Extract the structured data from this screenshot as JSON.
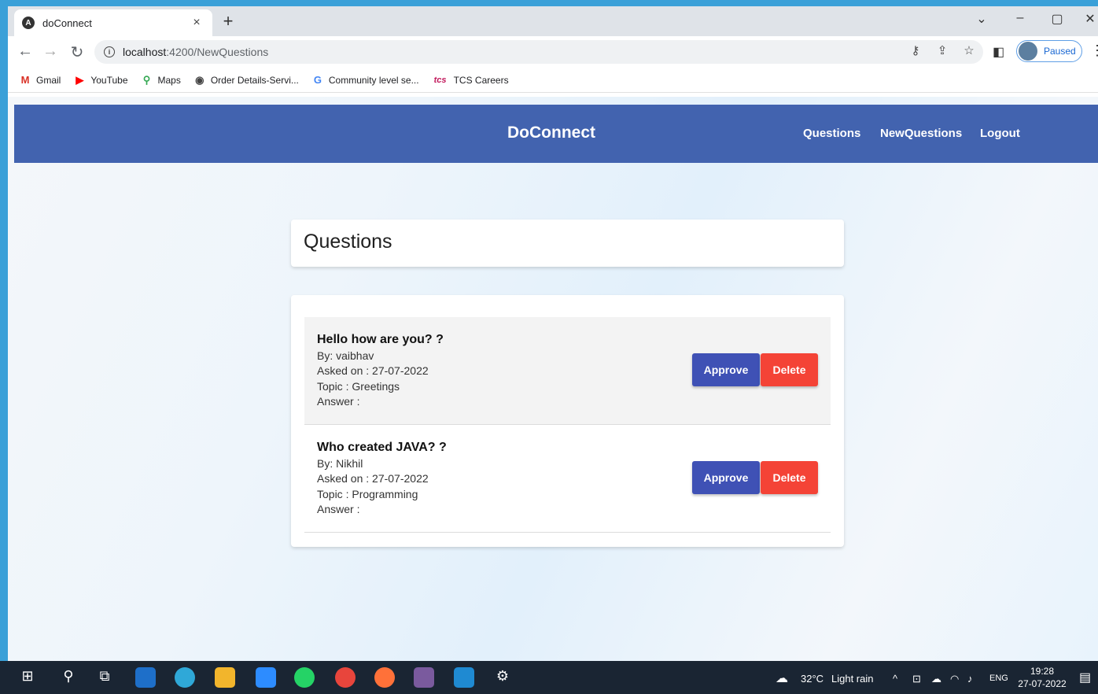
{
  "browser": {
    "tab_title": "doConnect",
    "tab_favicon": "A",
    "tab_close": "×",
    "new_tab": "+",
    "url_host": "localhost",
    "url_path": ":4200/NewQuestions",
    "profile_status": "Paused",
    "window_controls": [
      "⌄",
      "–",
      "▢",
      "✕"
    ]
  },
  "bookmarks": [
    {
      "icon": "M",
      "label": "Gmail",
      "color": "#d93025"
    },
    {
      "icon": "▶",
      "label": "YouTube",
      "color": "#ff0000"
    },
    {
      "icon": "⚲",
      "label": "Maps",
      "color": "#34a853"
    },
    {
      "icon": "◉",
      "label": "Order Details-Servi...",
      "color": "#444444"
    },
    {
      "icon": "G",
      "label": "Community level se...",
      "color": "#4285f4"
    },
    {
      "icon": "tcs",
      "label": "TCS Careers",
      "color": "#c2185b"
    }
  ],
  "app": {
    "brand": "DoConnect",
    "nav": [
      "Questions",
      "NewQuestions",
      "Logout"
    ],
    "page_title": "Questions"
  },
  "questions": [
    {
      "title": "Hello how are you? ?",
      "by": "By: vaibhav",
      "asked_on": "Asked on : 27-07-2022",
      "topic": "Topic : Greetings",
      "answer": "Answer :",
      "approve_label": "Approve",
      "delete_label": "Delete"
    },
    {
      "title": "Who created JAVA? ?",
      "by": "By: Nikhil",
      "asked_on": "Asked on : 27-07-2022",
      "topic": "Topic : Programming",
      "answer": "Answer :",
      "approve_label": "Approve",
      "delete_label": "Delete"
    }
  ],
  "taskbar": {
    "weather": "32°C",
    "weather_desc": "Light rain",
    "language": "ENG",
    "time": "19:28",
    "date": "27-07-2022"
  },
  "colors": {
    "header": "#4263af",
    "approve": "#3f51b5",
    "delete": "#f44336"
  }
}
